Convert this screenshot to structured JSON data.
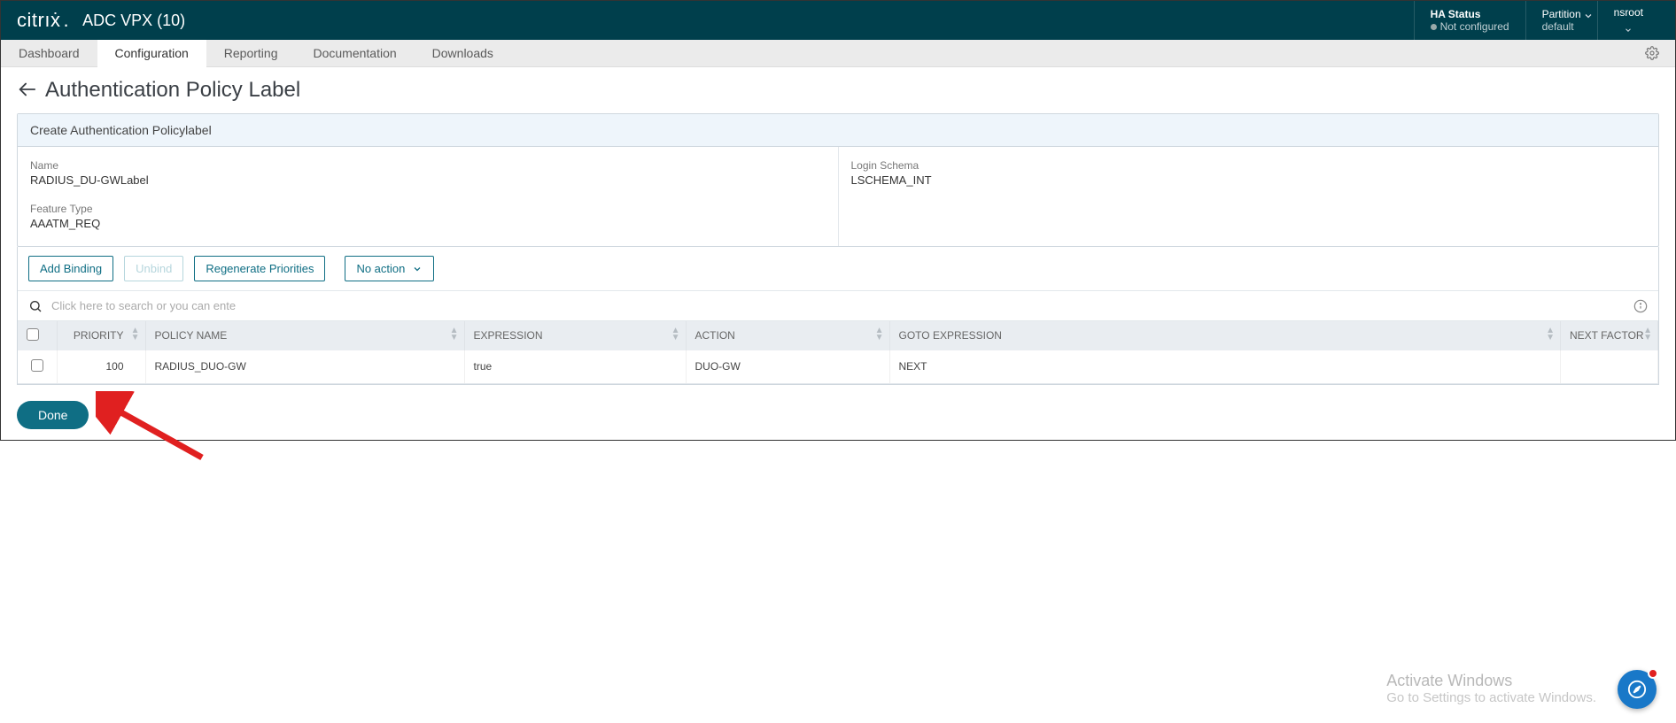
{
  "header": {
    "logo_text": "citrıẋ",
    "product": "ADC VPX (10)",
    "ha_title": "HA Status",
    "ha_status": "Not configured",
    "partition_title": "Partition",
    "partition_value": "default",
    "user": "nsroot"
  },
  "tabs": {
    "dashboard": "Dashboard",
    "configuration": "Configuration",
    "reporting": "Reporting",
    "documentation": "Documentation",
    "downloads": "Downloads"
  },
  "page_title": "Authentication Policy Label",
  "panel": {
    "header": "Create Authentication Policylabel",
    "name_label": "Name",
    "name_value": "RADIUS_DU-GWLabel",
    "feature_label": "Feature Type",
    "feature_value": "AAATM_REQ",
    "schema_label": "Login Schema",
    "schema_value": "LSCHEMA_INT"
  },
  "toolbar": {
    "add_binding": "Add Binding",
    "unbind": "Unbind",
    "regenerate": "Regenerate Priorities",
    "no_action": "No action"
  },
  "search": {
    "placeholder": "Click here to search or you can ente"
  },
  "table": {
    "cols": {
      "priority": "PRIORITY",
      "policy_name": "POLICY NAME",
      "expression": "EXPRESSION",
      "action": "ACTION",
      "goto": "GOTO EXPRESSION",
      "next_factor": "NEXT FACTOR"
    },
    "row": {
      "priority": "100",
      "policy_name": "RADIUS_DUO-GW",
      "expression": "true",
      "action": "DUO-GW",
      "goto": "NEXT",
      "next_factor": ""
    }
  },
  "done_label": "Done",
  "watermark": {
    "title": "Activate Windows",
    "subtitle": "Go to Settings to activate Windows."
  }
}
